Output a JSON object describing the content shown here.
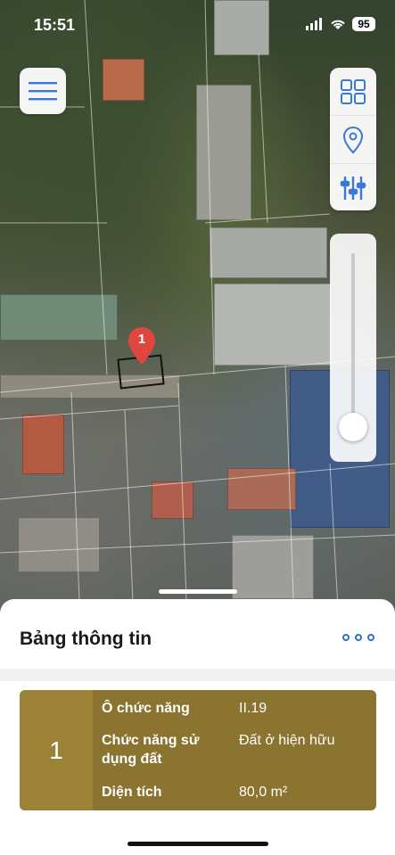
{
  "status_bar": {
    "time": "15:51",
    "battery": "95"
  },
  "map": {
    "marker_number": "1",
    "controls": [
      "grid-icon",
      "location-pin-icon",
      "sliders-icon"
    ],
    "opacity_level": 0.08
  },
  "sheet": {
    "title": "Bảng thông tin",
    "card": {
      "index": "1",
      "rows": [
        {
          "label": "Ô chức năng",
          "value": "II.19"
        },
        {
          "label": "Chức năng sử dụng đất",
          "value": "Đất ở hiện hữu"
        },
        {
          "label": "Diện tích",
          "value": "80,0 m²"
        }
      ]
    }
  },
  "colors": {
    "accent": "#2f6fd0",
    "card": "#8a7430",
    "card_index": "#9b8236",
    "marker": "#e0463e"
  }
}
